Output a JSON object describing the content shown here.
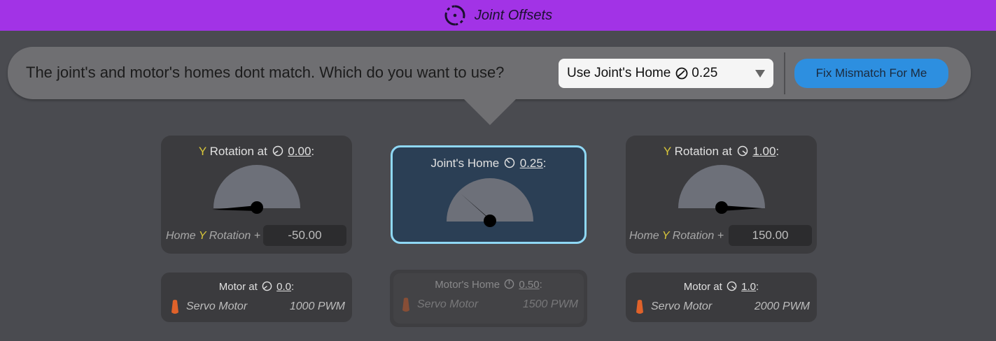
{
  "header": {
    "title": "Joint Offsets",
    "icon": "rotate-dashed-icon"
  },
  "prompt": {
    "question": "The joint's and motor's homes dont match. Which do you want to use?",
    "select_prefix": "Use Joint's Home",
    "select_value": "0.25",
    "fix_button": "Fix Mismatch For Me"
  },
  "left": {
    "axis": "Y",
    "label": "Rotation at",
    "value": "0.00",
    "home_prefix": "Home",
    "home_axis": "Y",
    "home_suffix": "Rotation +",
    "offset": "-50.00",
    "motor_label": "Motor at",
    "motor_value": "0.0",
    "motor_name": "Servo Motor",
    "pwm": "1000 PWM"
  },
  "center": {
    "label": "Joint's Home",
    "value": "0.25",
    "motor_label": "Motor's Home",
    "motor_value": "0.50",
    "motor_name": "Servo Motor",
    "pwm": "1500 PWM"
  },
  "right": {
    "axis": "Y",
    "label": "Rotation at",
    "value": "1.00",
    "home_prefix": "Home",
    "home_axis": "Y",
    "home_suffix": "Rotation +",
    "offset": "150.00",
    "motor_label": "Motor at",
    "motor_value": "1.0",
    "motor_name": "Servo Motor",
    "pwm": "2000 PWM"
  },
  "colors": {
    "topbar": "#a233e6",
    "accent_button": "#2d8fe0",
    "axis_yellow": "#d8c63a",
    "highlight_border": "#8fd8f5",
    "servo_orange": "#e0622a"
  }
}
